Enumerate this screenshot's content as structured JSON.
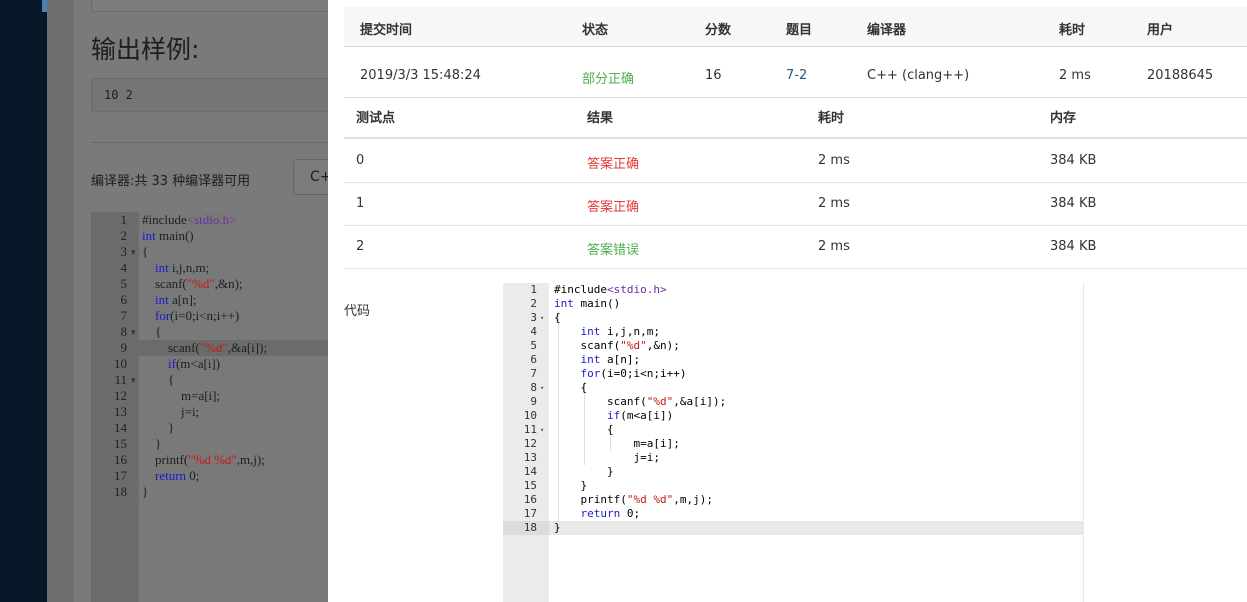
{
  "background_page": {
    "output_title": "输出样例:",
    "output_sample": "10 2",
    "compiler_info": "编译器:共 33 种编译器可用",
    "compiler_select_value": "C++",
    "code_lines": [
      {
        "n": "1",
        "fold": "",
        "text": "#include<stdio.h>"
      },
      {
        "n": "2",
        "fold": "",
        "text": "int main()"
      },
      {
        "n": "3",
        "fold": "▾",
        "text": "{"
      },
      {
        "n": "4",
        "fold": "",
        "text": "    int i,j,n,m;"
      },
      {
        "n": "5",
        "fold": "",
        "text": "    scanf(\"%d\",&n);"
      },
      {
        "n": "6",
        "fold": "",
        "text": "    int a[n];"
      },
      {
        "n": "7",
        "fold": "",
        "text": "    for(i=0;i<n;i++)"
      },
      {
        "n": "8",
        "fold": "▾",
        "text": "    {"
      },
      {
        "n": "9",
        "fold": "",
        "text": "        scanf(\"%d\",&a[i]);"
      },
      {
        "n": "10",
        "fold": "",
        "text": "        if(m<a[i])"
      },
      {
        "n": "11",
        "fold": "▾",
        "text": "        {"
      },
      {
        "n": "12",
        "fold": "",
        "text": "            m=a[i];"
      },
      {
        "n": "13",
        "fold": "",
        "text": "            j=i;"
      },
      {
        "n": "14",
        "fold": "",
        "text": "        }"
      },
      {
        "n": "15",
        "fold": "",
        "text": "    }"
      },
      {
        "n": "16",
        "fold": "",
        "text": "    printf(\"%d %d\",m,j);"
      },
      {
        "n": "17",
        "fold": "",
        "text": "    return 0;"
      },
      {
        "n": "18",
        "fold": "",
        "text": "}"
      }
    ]
  },
  "submission": {
    "headers": [
      "提交时间",
      "状态",
      "分数",
      "题目",
      "编译器",
      "耗时",
      "用户"
    ],
    "row": {
      "time": "2019/3/3 15:48:24",
      "status": "部分正确",
      "score": "16",
      "problem": "7-2",
      "compiler": "C++ (clang++)",
      "elapsed": "2 ms",
      "user": "20188645"
    }
  },
  "test_points": {
    "headers": [
      "测试点",
      "结果",
      "耗时",
      "内存"
    ],
    "rows": [
      {
        "id": "0",
        "result": "答案正确",
        "time": "2 ms",
        "memory": "384 KB"
      },
      {
        "id": "1",
        "result": "答案正确",
        "time": "2 ms",
        "memory": "384 KB"
      },
      {
        "id": "2",
        "result": "答案错误",
        "time": "2 ms",
        "memory": "384 KB"
      }
    ]
  },
  "code_section": {
    "label": "代码",
    "lines": [
      {
        "n": "1",
        "fold": "",
        "text": "#include<stdio.h>"
      },
      {
        "n": "2",
        "fold": "",
        "text": "int main()"
      },
      {
        "n": "3",
        "fold": "▾",
        "text": "{"
      },
      {
        "n": "4",
        "fold": "",
        "text": "    int i,j,n,m;"
      },
      {
        "n": "5",
        "fold": "",
        "text": "    scanf(\"%d\",&n);"
      },
      {
        "n": "6",
        "fold": "",
        "text": "    int a[n];"
      },
      {
        "n": "7",
        "fold": "",
        "text": "    for(i=0;i<n;i++)"
      },
      {
        "n": "8",
        "fold": "▾",
        "text": "    {"
      },
      {
        "n": "9",
        "fold": "",
        "text": "        scanf(\"%d\",&a[i]);"
      },
      {
        "n": "10",
        "fold": "",
        "text": "        if(m<a[i])"
      },
      {
        "n": "11",
        "fold": "▾",
        "text": "        {"
      },
      {
        "n": "12",
        "fold": "",
        "text": "            m=a[i];"
      },
      {
        "n": "13",
        "fold": "",
        "text": "            j=i;"
      },
      {
        "n": "14",
        "fold": "",
        "text": "        }"
      },
      {
        "n": "15",
        "fold": "",
        "text": "    }"
      },
      {
        "n": "16",
        "fold": "",
        "text": "    printf(\"%d %d\",m,j);"
      },
      {
        "n": "17",
        "fold": "",
        "text": "    return 0;"
      },
      {
        "n": "18",
        "fold": "",
        "text": "}"
      }
    ]
  },
  "colors": {
    "correct": "#4caf50",
    "wrong_test": "#e53935",
    "link": "#1e5a8c",
    "keyword": "#1a1ad0",
    "string": "#c41a16"
  }
}
